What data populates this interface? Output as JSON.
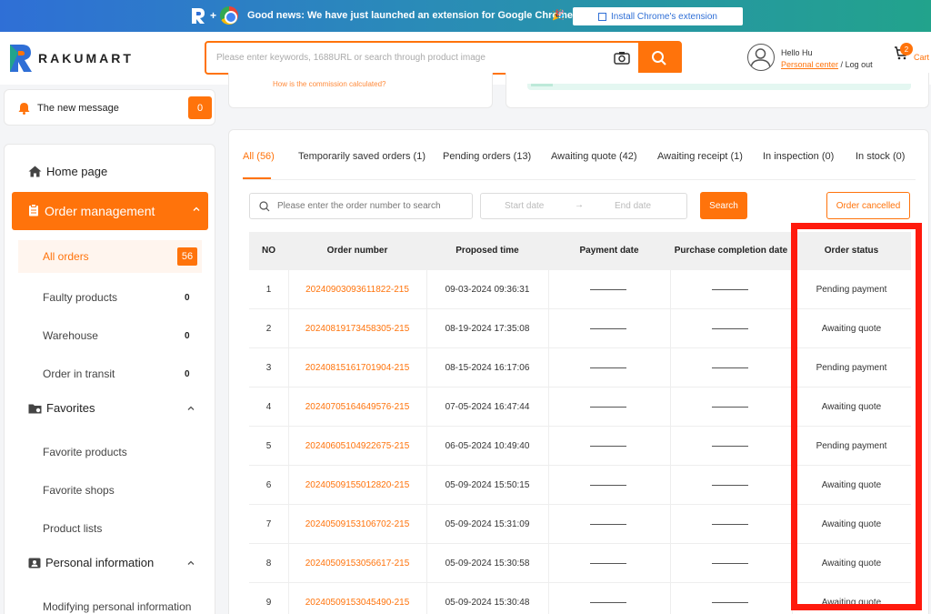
{
  "banner": {
    "news": "Good news: We have just launched an extension for Google Chrome",
    "party": "🎉",
    "install_label": "Install Chrome's extension"
  },
  "header": {
    "logo_text": "RAKUMART",
    "search_placeholder": "Please enter keywords, 1688URL or search through product image",
    "greeting": "Hello Hu",
    "personal_center": "Personal center",
    "separator": " / ",
    "logout": "Log out",
    "cart_count": "2",
    "cart_label": "Cart"
  },
  "message": {
    "label": "The new message",
    "count": "0"
  },
  "top_cards": {
    "commission_question": "How is the commission calculated?"
  },
  "sidebar": {
    "home": "Home page",
    "order_management": "Order management",
    "all_orders": "All orders",
    "all_orders_count": "56",
    "order_subs": [
      {
        "label": "Faulty products",
        "count": "0"
      },
      {
        "label": "Warehouse",
        "count": "0"
      },
      {
        "label": "Order in transit",
        "count": "0"
      }
    ],
    "favorites": "Favorites",
    "favorite_subs": [
      "Favorite products",
      "Favorite shops",
      "Product lists"
    ],
    "personal_information": "Personal information",
    "personal_subs": [
      "Modifying personal information"
    ]
  },
  "tabs": [
    "All (56)",
    "Temporarily saved orders (1)",
    "Pending orders (13)",
    "Awaiting quote (42)",
    "Awaiting receipt (1)",
    "In inspection (0)",
    "In stock (0)"
  ],
  "filters": {
    "search_placeholder": "Please enter the order number to search",
    "start_date": "Start date",
    "arrow": "→",
    "end_date": "End date",
    "search_button": "Search",
    "cancelled_button": "Order cancelled"
  },
  "table": {
    "headers": [
      "NO",
      "Order number",
      "Proposed time",
      "Payment date",
      "Purchase completion date",
      "Order status"
    ],
    "rows": [
      {
        "no": "1",
        "order": "20240903093611822-215",
        "time": "09-03-2024 09:36:31",
        "status": "Pending payment"
      },
      {
        "no": "2",
        "order": "20240819173458305-215",
        "time": "08-19-2024 17:35:08",
        "status": "Awaiting quote"
      },
      {
        "no": "3",
        "order": "20240815161701904-215",
        "time": "08-15-2024 16:17:06",
        "status": "Pending payment"
      },
      {
        "no": "4",
        "order": "20240705164649576-215",
        "time": "07-05-2024 16:47:44",
        "status": "Awaiting quote"
      },
      {
        "no": "5",
        "order": "20240605104922675-215",
        "time": "06-05-2024 10:49:40",
        "status": "Pending payment"
      },
      {
        "no": "6",
        "order": "20240509155012820-215",
        "time": "05-09-2024 15:50:15",
        "status": "Awaiting quote"
      },
      {
        "no": "7",
        "order": "20240509153106702-215",
        "time": "05-09-2024 15:31:09",
        "status": "Awaiting quote"
      },
      {
        "no": "8",
        "order": "20240509153056617-215",
        "time": "05-09-2024 15:30:58",
        "status": "Awaiting quote"
      },
      {
        "no": "9",
        "order": "20240509153045490-215",
        "time": "05-09-2024 15:30:48",
        "status": "Awaiting quote"
      }
    ]
  },
  "colors": {
    "accent": "#ff730b",
    "highlight": "#ff1a0d"
  }
}
